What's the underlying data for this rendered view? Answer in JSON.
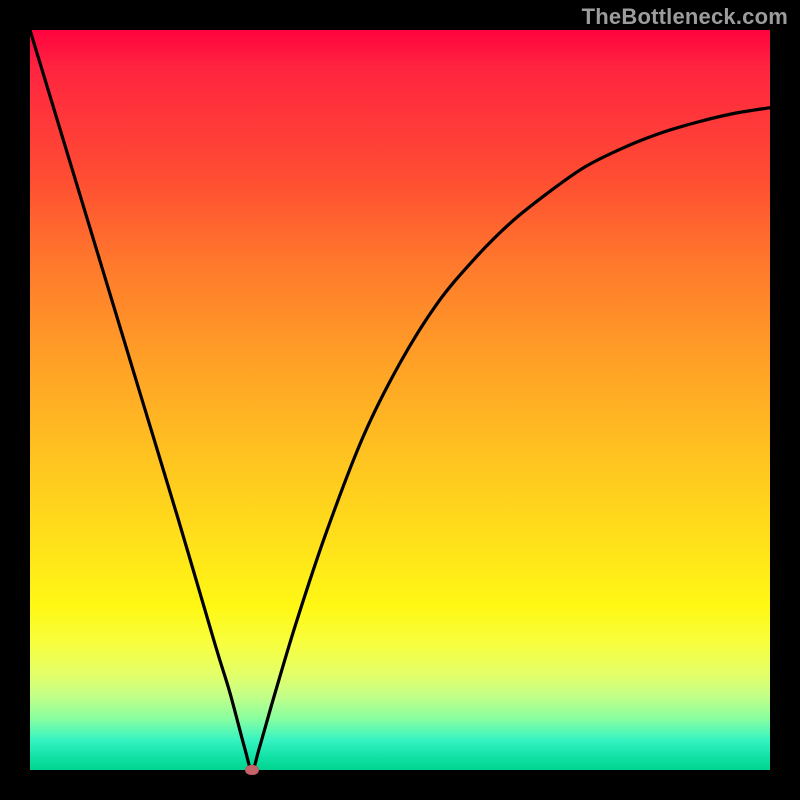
{
  "watermark": "TheBottleneck.com",
  "chart_data": {
    "type": "line",
    "title": "",
    "xlabel": "",
    "ylabel": "",
    "xlim": [
      0,
      100
    ],
    "ylim": [
      0,
      100
    ],
    "grid": false,
    "legend": false,
    "series": [
      {
        "name": "curve",
        "color": "#000000",
        "x": [
          0,
          5,
          10,
          15,
          20,
          25,
          27,
          29,
          30,
          31,
          33,
          36,
          40,
          45,
          50,
          55,
          60,
          65,
          70,
          75,
          80,
          85,
          90,
          95,
          100
        ],
        "y": [
          100,
          83.5,
          67,
          50.5,
          34,
          17,
          10.5,
          3,
          0,
          3,
          10,
          20,
          32,
          45,
          55,
          63,
          69,
          74,
          78,
          81.5,
          84,
          86,
          87.5,
          88.7,
          89.5
        ]
      }
    ],
    "annotations": [
      {
        "type": "point",
        "x": 30,
        "y": 0,
        "color": "#c4646a"
      }
    ]
  }
}
